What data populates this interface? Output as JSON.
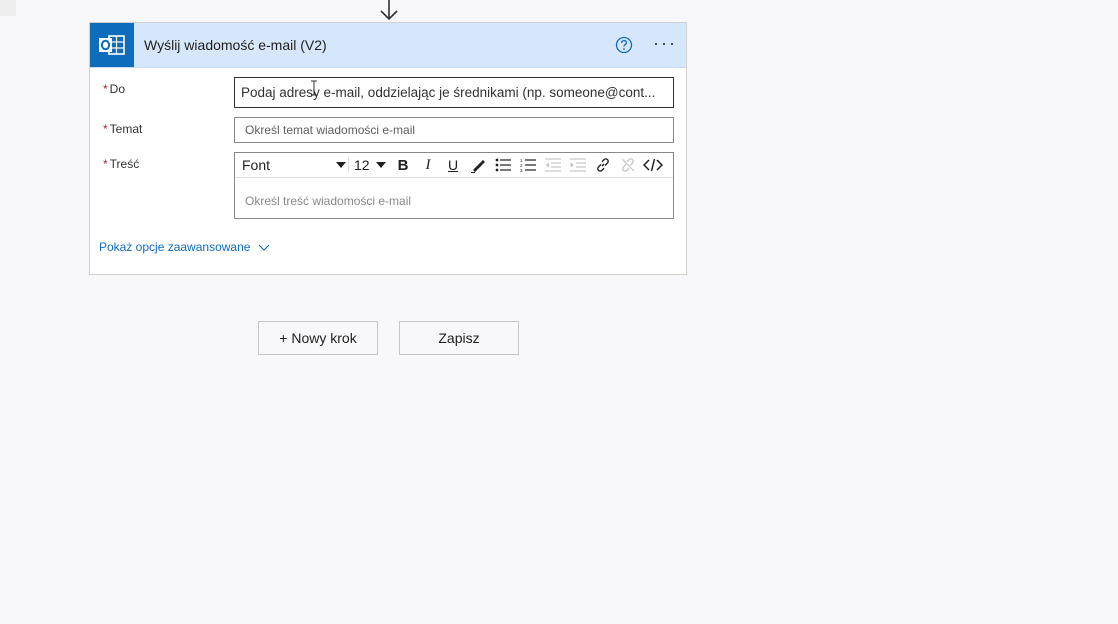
{
  "card": {
    "title": "Wyślij wiadomość e-mail (V2)",
    "app_icon": "outlook-icon",
    "header_color": "#d6e7fb",
    "accent": "#0f6cbd"
  },
  "fields": {
    "to": {
      "label": "Do",
      "required_mark": "*",
      "placeholder": "Podaj adresy e-mail, oddzielając je średnikami (np. someone@cont..."
    },
    "subject": {
      "label": "Temat",
      "required_mark": "*",
      "placeholder": "Określ temat wiadomości e-mail"
    },
    "body": {
      "label": "Treść",
      "required_mark": "*",
      "placeholder": "Określ treść wiadomości e-mail"
    }
  },
  "toolbar": {
    "font": "Font",
    "size": "12",
    "bold": "B",
    "italic": "I",
    "underline": "U"
  },
  "advanced_link": "Pokaż opcje zaawansowane",
  "buttons": {
    "new_step": "+ Nowy krok",
    "save": "Zapisz"
  }
}
